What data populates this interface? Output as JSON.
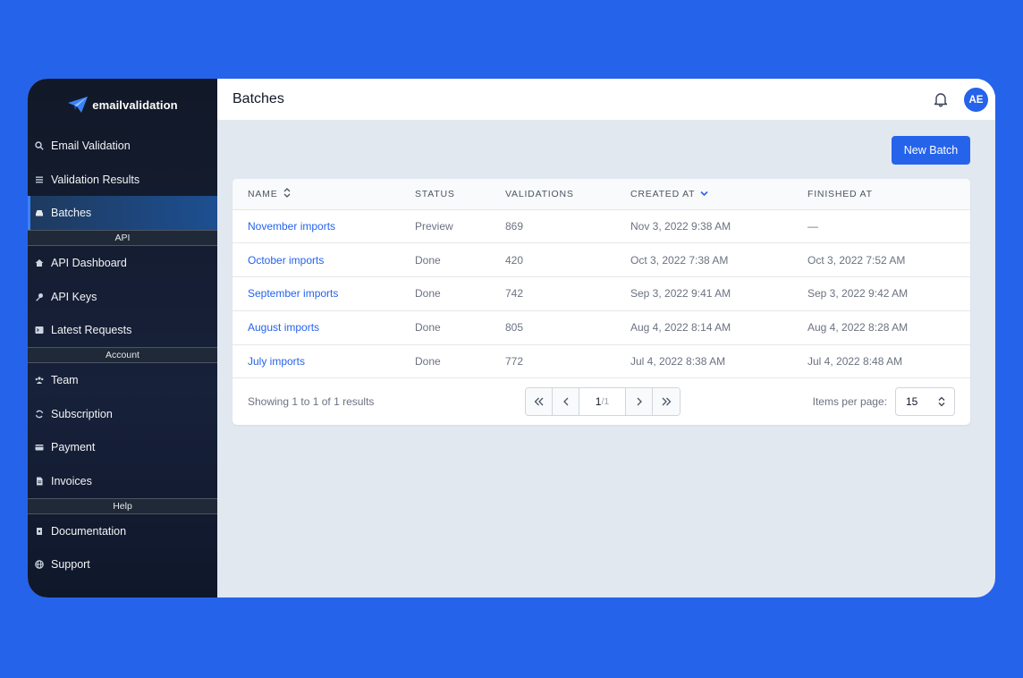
{
  "brand": {
    "name": "emailvalidation"
  },
  "sidebar": {
    "items": [
      {
        "label": "Email Validation",
        "icon": "search-icon"
      },
      {
        "label": "Validation Results",
        "icon": "list-icon"
      },
      {
        "label": "Batches",
        "icon": "stack-icon",
        "active": true
      }
    ],
    "sections": [
      {
        "title": "API",
        "items": [
          {
            "label": "API Dashboard",
            "icon": "home-icon"
          },
          {
            "label": "API Keys",
            "icon": "key-icon"
          },
          {
            "label": "Latest Requests",
            "icon": "terminal-icon"
          }
        ]
      },
      {
        "title": "Account",
        "items": [
          {
            "label": "Team",
            "icon": "users-icon"
          },
          {
            "label": "Subscription",
            "icon": "refresh-icon"
          },
          {
            "label": "Payment",
            "icon": "credit-card-icon"
          },
          {
            "label": "Invoices",
            "icon": "document-icon"
          }
        ]
      },
      {
        "title": "Help",
        "items": [
          {
            "label": "Documentation",
            "icon": "book-icon"
          },
          {
            "label": "Support",
            "icon": "globe-icon"
          }
        ]
      }
    ]
  },
  "header": {
    "title": "Batches",
    "avatar_initials": "AE"
  },
  "actions": {
    "new_batch": "New Batch"
  },
  "table": {
    "columns": [
      "NAME",
      "STATUS",
      "VALIDATIONS",
      "CREATED AT",
      "FINISHED AT"
    ],
    "rows": [
      [
        "November imports",
        "Preview",
        "869",
        "Nov 3, 2022 9:38 AM",
        "—"
      ],
      [
        "October imports",
        "Done",
        "420",
        "Oct 3, 2022 7:38 AM",
        "Oct 3, 2022 7:52 AM"
      ],
      [
        "September imports",
        "Done",
        "742",
        "Sep 3, 2022 9:41 AM",
        "Sep 3, 2022 9:42 AM"
      ],
      [
        "August imports",
        "Done",
        "805",
        "Aug 4, 2022 8:14 AM",
        "Aug 4, 2022 8:28 AM"
      ],
      [
        "July imports",
        "Done",
        "772",
        "Jul 4, 2022 8:38 AM",
        "Jul 4, 2022 8:48 AM"
      ]
    ]
  },
  "pagination": {
    "showing": "Showing 1 to 1 of 1 results",
    "current_page": "1",
    "total_pages": "/1",
    "items_per_page_label": "Items per page:",
    "items_per_page": "15"
  },
  "colors": {
    "accent": "#2563eb",
    "sidebar_bg": "#111827",
    "content_bg": "#e2e8f0"
  }
}
